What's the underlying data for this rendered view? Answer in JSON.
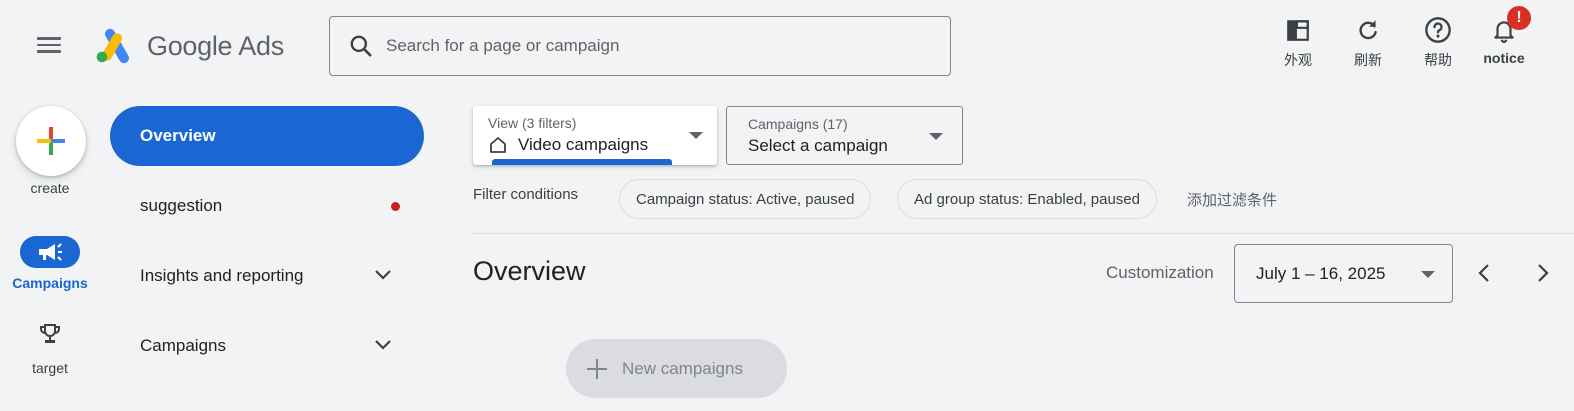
{
  "header": {
    "logo_text_main": "Google",
    "logo_text_product": "Ads",
    "search_placeholder": "Search for a page or campaign",
    "actions": [
      {
        "label": "外观",
        "icon": "appearance-icon"
      },
      {
        "label": "刷新",
        "icon": "refresh-icon"
      },
      {
        "label": "帮助",
        "icon": "help-icon"
      },
      {
        "label": "notice",
        "icon": "notification-bell-icon",
        "badge": "!"
      }
    ]
  },
  "rail": {
    "create_label": "create",
    "campaigns_label": "Campaigns",
    "target_label": "target"
  },
  "nav": {
    "items": [
      {
        "label": "Overview",
        "active": true
      },
      {
        "label": "suggestion",
        "has_dot": true
      },
      {
        "label": "Insights and reporting",
        "expandable": true
      },
      {
        "label": "Campaigns",
        "expandable": true
      }
    ]
  },
  "view_selector": {
    "sub_label": "View (3 filters)",
    "value": "Video campaigns"
  },
  "campaign_selector": {
    "sub_label": "Campaigns (17)",
    "value": "Select a campaign"
  },
  "filters": {
    "label": "Filter conditions",
    "chips": [
      "Campaign status: Active, paused",
      "Ad group status: Enabled, paused"
    ],
    "add_label": "添加过滤条件"
  },
  "main": {
    "title": "Overview",
    "customization_label": "Customization",
    "date_range": "July 1 – 16, 2025",
    "new_campaign_label": "New campaigns"
  },
  "colors": {
    "primary_blue": "#1a66d2",
    "alert_red": "#d93025",
    "background": "#f1f3f4"
  }
}
